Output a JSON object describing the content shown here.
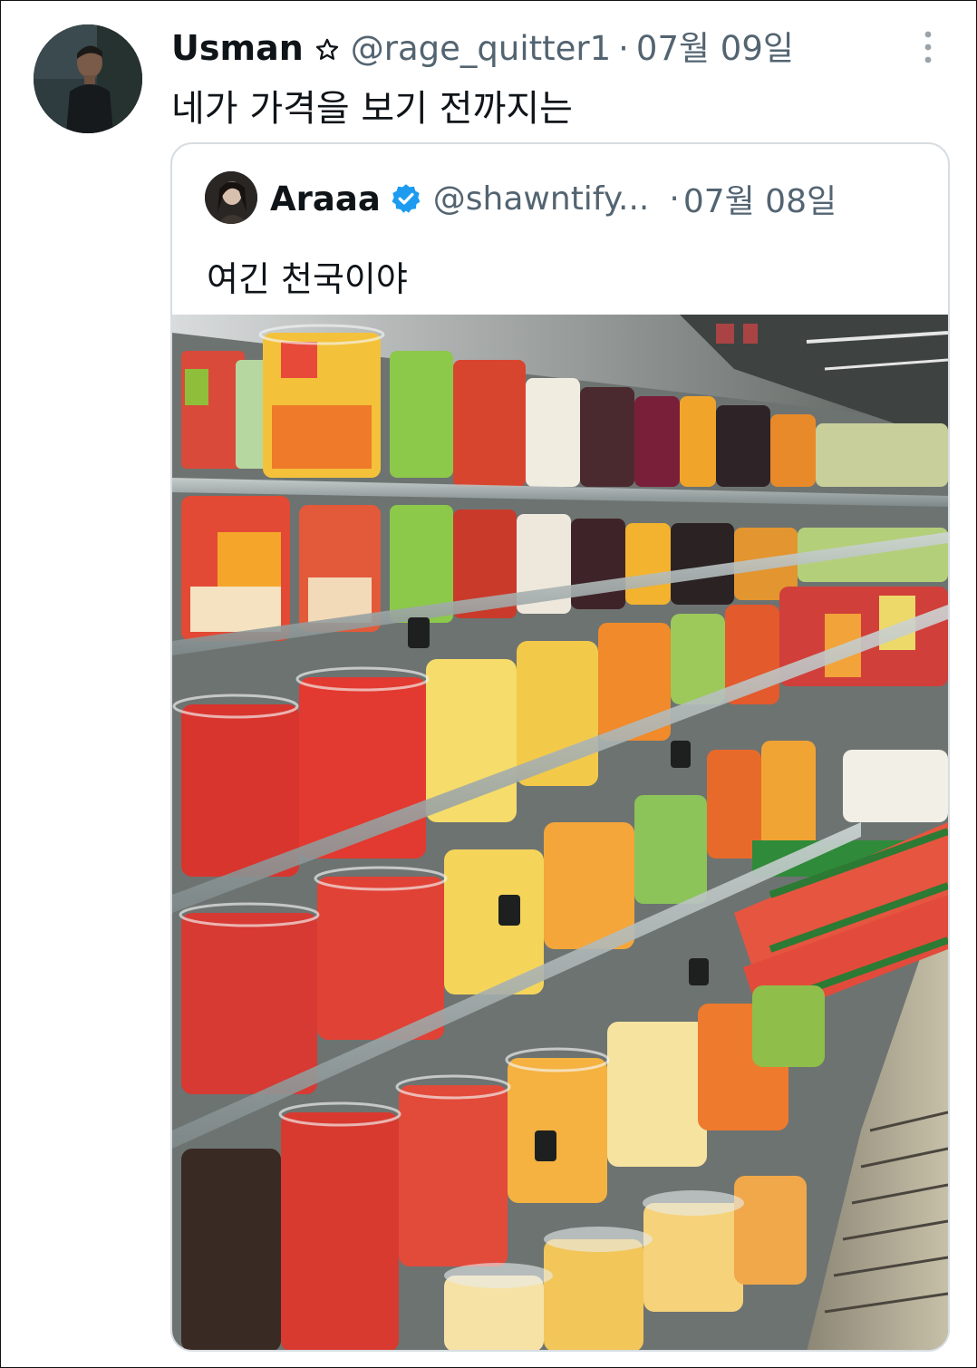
{
  "tweet": {
    "author_name": "Usman",
    "author_handle": "@rage_quitter1",
    "separator": "·",
    "date": "07월 09일",
    "text": "네가 가격을 보기 전까지는",
    "badge_icon": "star-outline-icon",
    "menu_icon": "more-vertical-icon"
  },
  "quoted_tweet": {
    "author_name": "Araaa",
    "author_handle": "@shawntify...",
    "separator": "·",
    "date": "07월 08일",
    "text": "여긴 천국이야",
    "badge_icon": "verified-badge-icon",
    "image_subject": "fruit-cups-display-image"
  },
  "colors": {
    "text_primary": "#0f1419",
    "text_secondary": "#536471",
    "verified_blue": "#1d9bf0",
    "card_border": "#d7dde2"
  }
}
